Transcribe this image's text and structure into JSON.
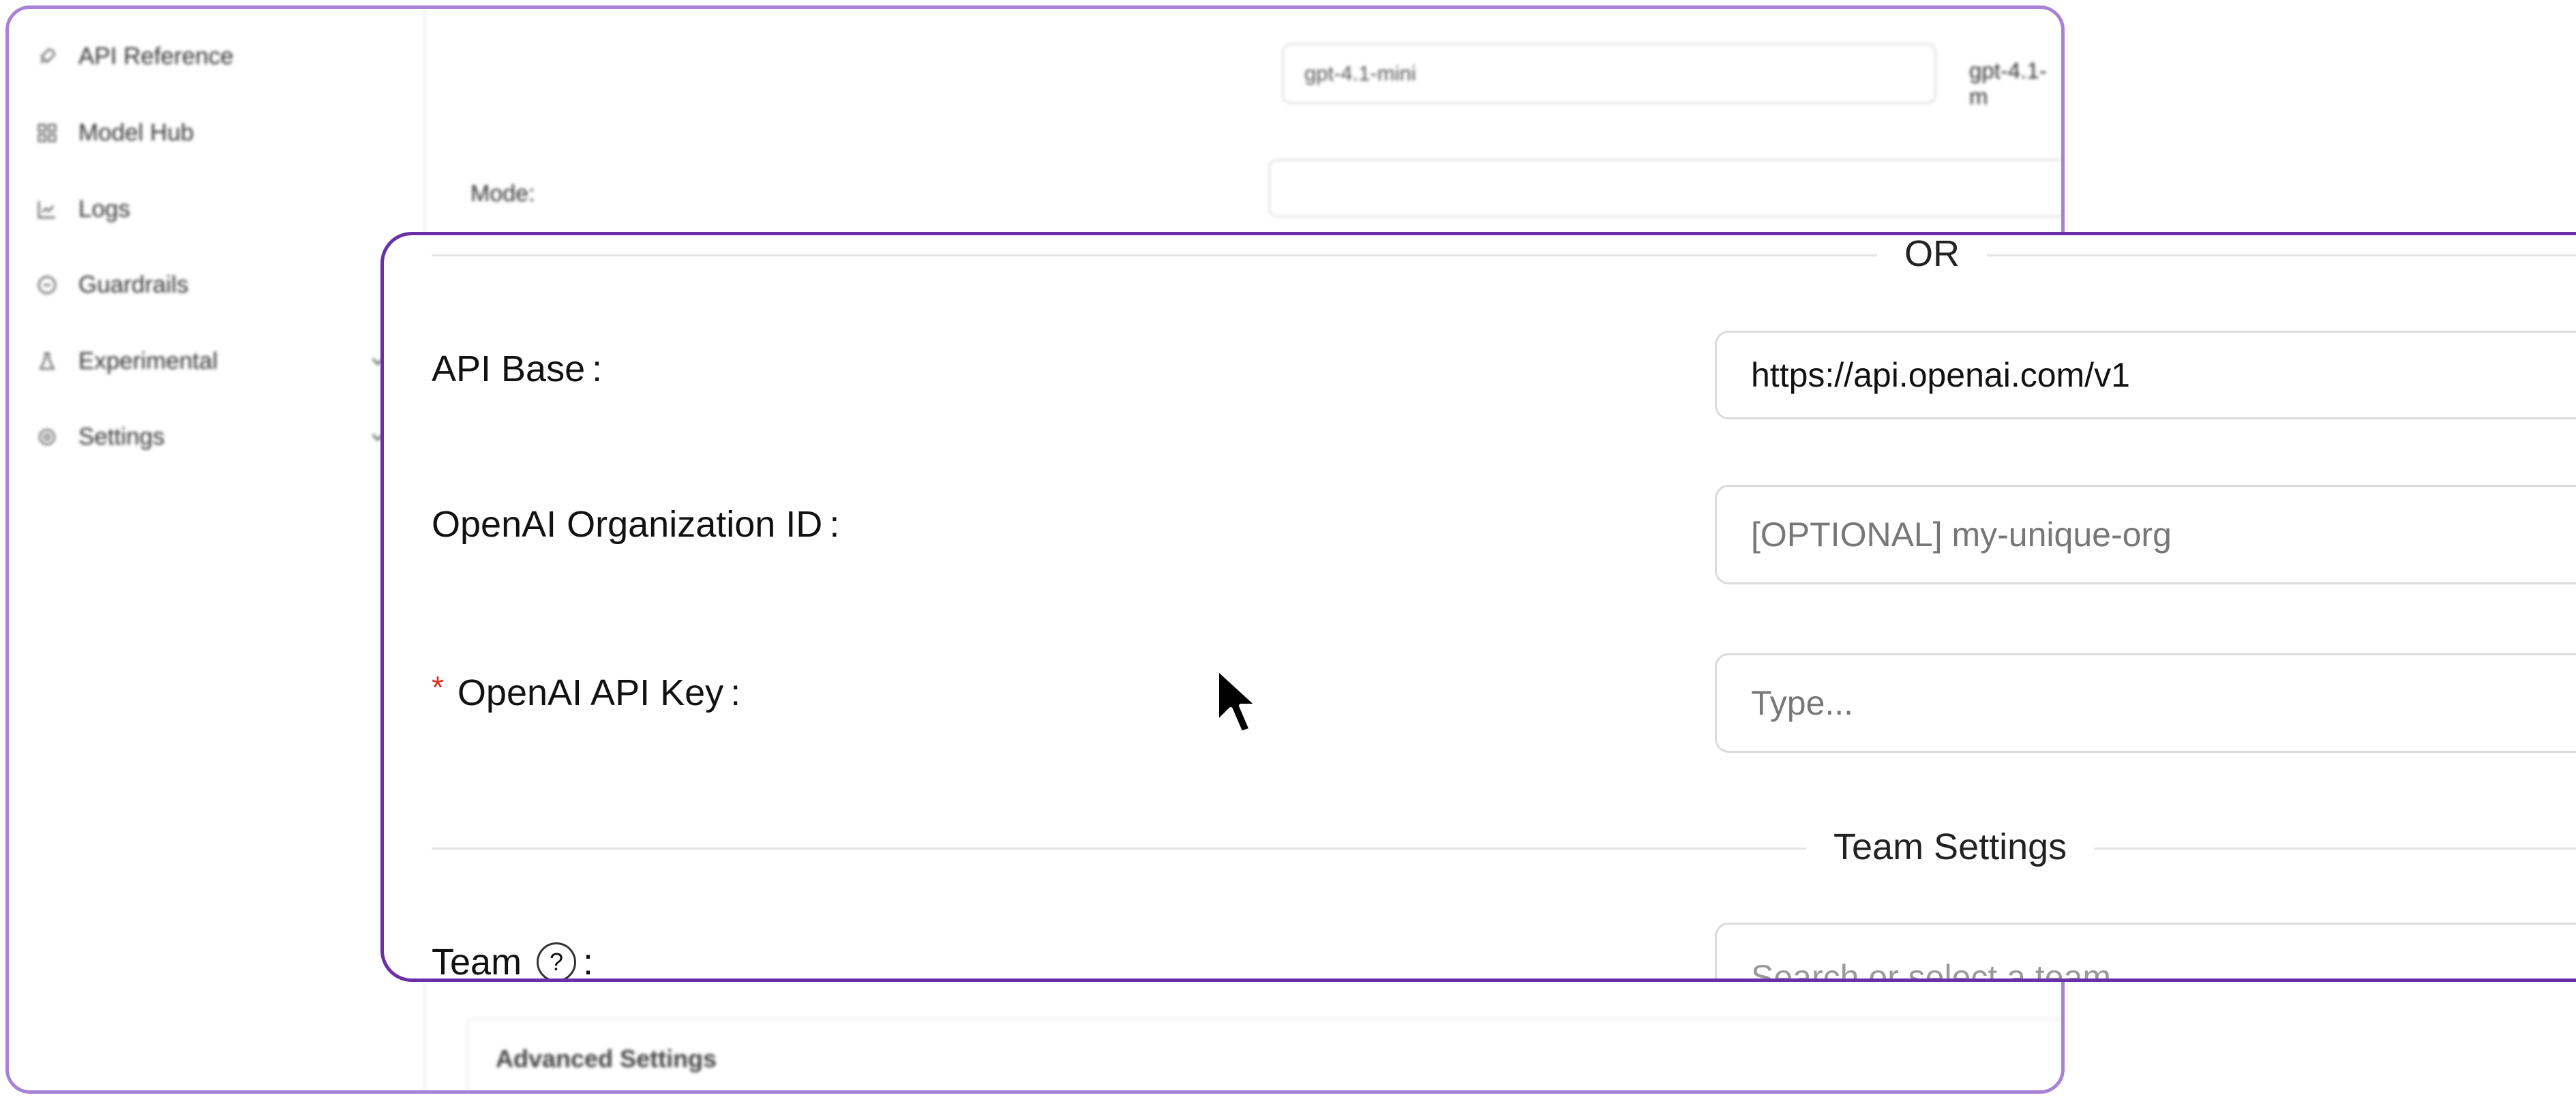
{
  "sidebar": {
    "items": [
      {
        "label": "API Reference",
        "icon": "rocket-icon"
      },
      {
        "label": "Model Hub",
        "icon": "grid-icon"
      },
      {
        "label": "Logs",
        "icon": "line-chart-icon"
      },
      {
        "label": "Guardrails",
        "icon": "shield-icon"
      },
      {
        "label": "Experimental",
        "icon": "flask-icon",
        "expandable": true
      },
      {
        "label": "Settings",
        "icon": "gear-icon",
        "expandable": true
      }
    ]
  },
  "background_form": {
    "model_input_value": "gpt-4.1-mini",
    "model_badge": "gpt-4.1-m",
    "mode_label": "Mode",
    "advanced_settings_title": "Advanced Settings"
  },
  "form": {
    "or_divider": "OR",
    "api_base_label": "API Base",
    "api_base_value": "https://api.openai.com/v1",
    "org_id_label": "OpenAI Organization ID",
    "org_id_placeholder": "[OPTIONAL] my-unique-org",
    "api_key_label": "OpenAI API Key",
    "api_key_required_mark": "*",
    "api_key_placeholder": "Type...",
    "team_settings_divider": "Team Settings",
    "team_label": "Team",
    "team_help_glyph": "?",
    "team_placeholder": "Search or select a team",
    "label_colon": ":"
  },
  "colors": {
    "panel_border": "#6a2fa8",
    "window_border": "#a882d4",
    "required": "#d0342c"
  }
}
